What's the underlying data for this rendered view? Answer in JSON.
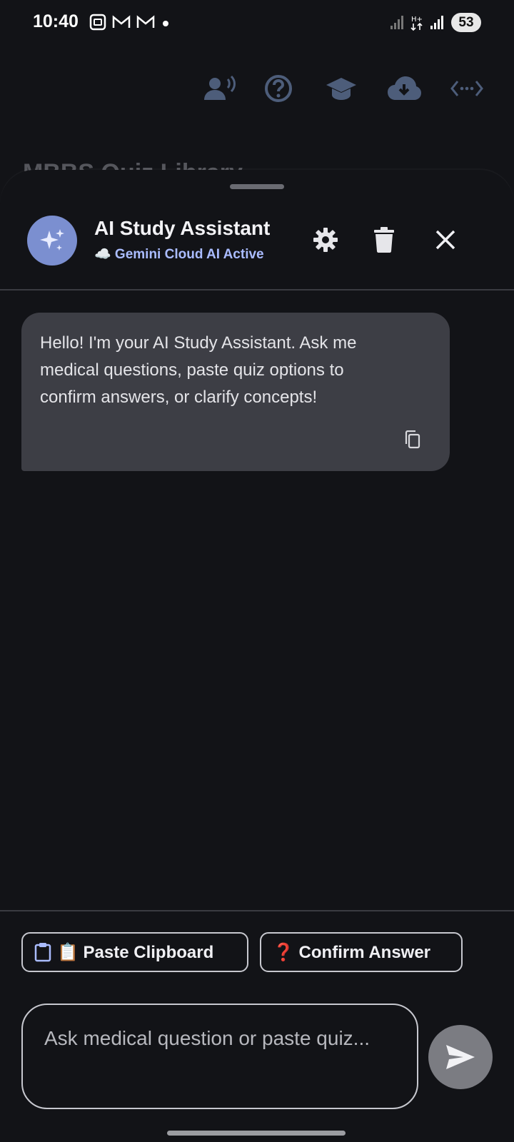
{
  "status_bar": {
    "time": "10:40",
    "battery": "53",
    "icons": [
      "screenshot-icon",
      "gmail-icon",
      "gmail-icon",
      "notification-dot",
      "signal-icon",
      "data-icon",
      "signal-icon"
    ]
  },
  "toolbar": {
    "icons": [
      "voice-user-icon",
      "help-icon",
      "graduation-cap-icon",
      "cloud-download-icon",
      "code-dots-icon"
    ]
  },
  "background_title": "MBBS Quiz Library",
  "sheet": {
    "title": "AI Study Assistant",
    "status": "☁️ Gemini Cloud AI Active",
    "header_buttons": [
      "settings-icon",
      "delete-icon",
      "close-icon"
    ]
  },
  "messages": [
    {
      "sender": "assistant",
      "text": "Hello! I'm your AI Study Assistant. Ask me medical questions, paste quiz options to confirm answers, or clarify concepts!"
    }
  ],
  "quick_actions": {
    "paste_label": "📋 Paste Clipboard",
    "confirm_label": "❓ Confirm Answer"
  },
  "composer": {
    "placeholder": "Ask medical question or paste quiz..."
  },
  "colors": {
    "background": "#121317",
    "bubble": "#3d3e45",
    "accent": "#7b8fd0",
    "status_text": "#aabcff"
  }
}
